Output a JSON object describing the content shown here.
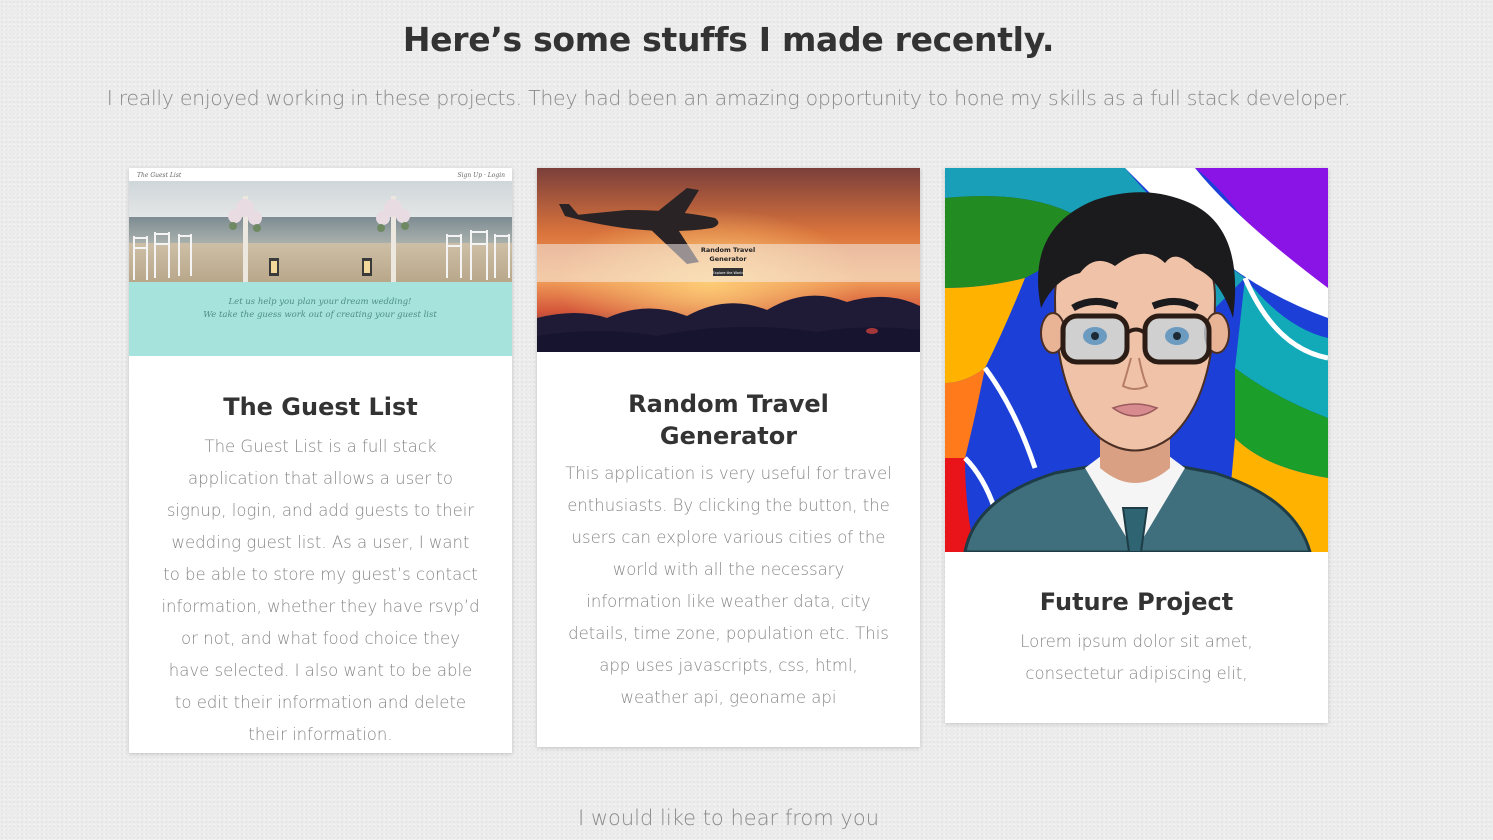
{
  "header": {
    "title": "Here’s some stuffs I made recently.",
    "subtitle": "I really enjoyed working in these projects. They had been an amazing opportunity to hone my skills as a full stack developer."
  },
  "projects": [
    {
      "title": "The Guest List",
      "description": "The Guest List is a full stack application that allows a user to signup, login, and add guests to their wedding guest list. As a user, I want to be able to store my guest’s contact information, whether they have rsvp’d or not, and what food choice they have selected. I also want to be able to edit their information and delete their information.",
      "screenshot": {
        "brand": "The Guest List",
        "nav": "Sign Up · Login",
        "tagline_1": "Let us help you plan your dream wedding!",
        "tagline_2": "We take the guess work out of creating your guest list"
      }
    },
    {
      "title": "Random Travel Generator",
      "description": "This application is very useful for travel enthusiasts. By clicking the button, the users can explore various cities of the world with all the necessary information like weather data, city details, time zone, population etc. This app uses javascripts, css, html, weather api, geoname api",
      "screenshot": {
        "heading_1": "Random Travel",
        "heading_2": "Generator",
        "button": "Explore the World"
      }
    },
    {
      "title": "Future Project",
      "description": "Lorem ipsum dolor sit amet, consectetur adipiscing elit,"
    }
  ],
  "footer": {
    "text": "I would like to hear from you"
  },
  "colors": {
    "background": "#ececec",
    "heading": "#333333",
    "muted_text": "#888888",
    "guest_list_teal": "#a6e3dd"
  }
}
